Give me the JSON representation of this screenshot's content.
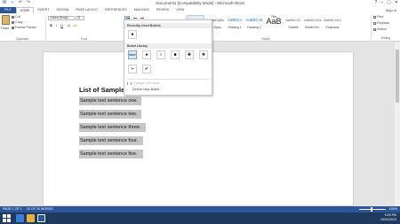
{
  "window": {
    "title": "Document1 [Compatibility Mode] - Microsoft Word",
    "sign_in": "Sign in",
    "controls": [
      "?",
      "–",
      "▢",
      "✕"
    ]
  },
  "tabs": [
    "FILE",
    "HOME",
    "INSERT",
    "DESIGN",
    "PAGE LAYOUT",
    "REFERENCES",
    "MAILINGS",
    "REVIEW",
    "VIEW"
  ],
  "ribbon": {
    "clipboard": {
      "paste": "Paste",
      "cut": "Cut",
      "copy": "Copy",
      "format_painter": "Format Painter",
      "label": "Clipboard"
    },
    "font": {
      "name": "Calibri (Body)",
      "size": "11",
      "bold": "B",
      "italic": "I",
      "underline": "U",
      "label": "Font"
    },
    "styles": {
      "items": [
        {
          "sample": "AaBbCcDc",
          "name": "¶ Normal",
          "cls": "sel"
        },
        {
          "sample": "AaBbCcDc",
          "name": "¶ No Spac...",
          "cls": ""
        },
        {
          "sample": "AaBbCc",
          "name": "Heading 1",
          "cls": "h1"
        },
        {
          "sample": "AaBbCcE",
          "name": "Heading 2",
          "cls": "h1"
        },
        {
          "sample": "AaB",
          "name": "Title",
          "cls": "title"
        },
        {
          "sample": "AaBbCcC",
          "name": "Subtitle",
          "cls": "sub"
        },
        {
          "sample": "AaBbCcDc",
          "name": "Subtle Em...",
          "cls": "sub"
        },
        {
          "sample": "AaBbCcDc",
          "name": "Emphasis",
          "cls": "sub"
        }
      ],
      "label": "Styles"
    },
    "editing": {
      "find": "Find",
      "replace": "Replace",
      "select": "Select",
      "label": "Editing"
    }
  },
  "bullet_menu": {
    "recent_header": "Recently Used Bullets",
    "library_header": "Bullet Library",
    "recent": [
      "●"
    ],
    "library": [
      "None",
      "●",
      "○",
      "■",
      "✤",
      "❖"
    ],
    "library_row2": [
      "➢",
      "✔"
    ],
    "change_level": "Change List Level",
    "define_new": "Define New Bullet..."
  },
  "document": {
    "heading": "List of Sample Text",
    "lines": [
      "Sample text sentence one.",
      "Sample text sentence two.",
      "Sample text sentence three.",
      "Sample text sentence four.",
      "Sample text sentence five."
    ]
  },
  "status": {
    "page": "PAGE 1 OF 1",
    "words": "20 OF 24 WORDS",
    "zoom": "100%"
  },
  "taskbar": {
    "clock": "9:25 PM\n10/31/2013"
  }
}
